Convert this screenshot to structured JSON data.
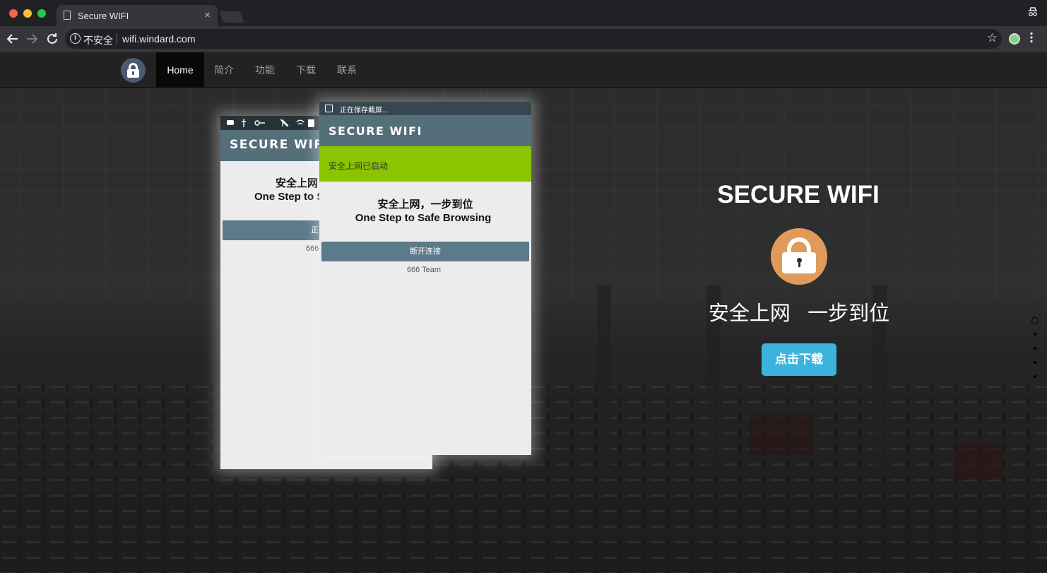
{
  "browser": {
    "tab_title": "Secure WIFI",
    "tab_close": "×",
    "security_label": "不安全",
    "url": "wifi.windard.com",
    "star": "☆",
    "menu": "⋮",
    "icons": [
      "close-icon",
      "minimize-icon",
      "maximize-icon",
      "document-icon",
      "back-icon",
      "forward-icon",
      "reload-icon",
      "info-icon",
      "star-icon",
      "extension-icon",
      "menu-icon",
      "incognito-icon"
    ]
  },
  "site_nav": {
    "items": [
      {
        "label": "Home",
        "active": true
      },
      {
        "label": "简介",
        "active": false
      },
      {
        "label": "功能",
        "active": false
      },
      {
        "label": "下载",
        "active": false
      },
      {
        "label": "联系",
        "active": false
      }
    ]
  },
  "phone_back": {
    "brand": "SECURE WIFI",
    "line1": "安全上网，一步到位",
    "line2": "One Step to Safe Browsing",
    "button": "正在连接",
    "footer": "666 Team"
  },
  "phone_front": {
    "status_text": "正在保存截屏...",
    "brand": "SECURE WIFI",
    "banner": "安全上网已启动",
    "line1": "安全上网，一步到位",
    "line2": "One Step to Safe Browsing",
    "button": "断开连接",
    "footer": "666 Team"
  },
  "hero": {
    "title": "SECURE WIFI",
    "subtitle": "安全上网   一步到位",
    "download_button": "点击下载"
  },
  "colors": {
    "accent": "#3ab4dc",
    "lock": "#e09a5a",
    "banner_green": "#8bc400",
    "app_bar": "#546e7a"
  },
  "section_dots": {
    "count": 5,
    "active_index": 0
  }
}
